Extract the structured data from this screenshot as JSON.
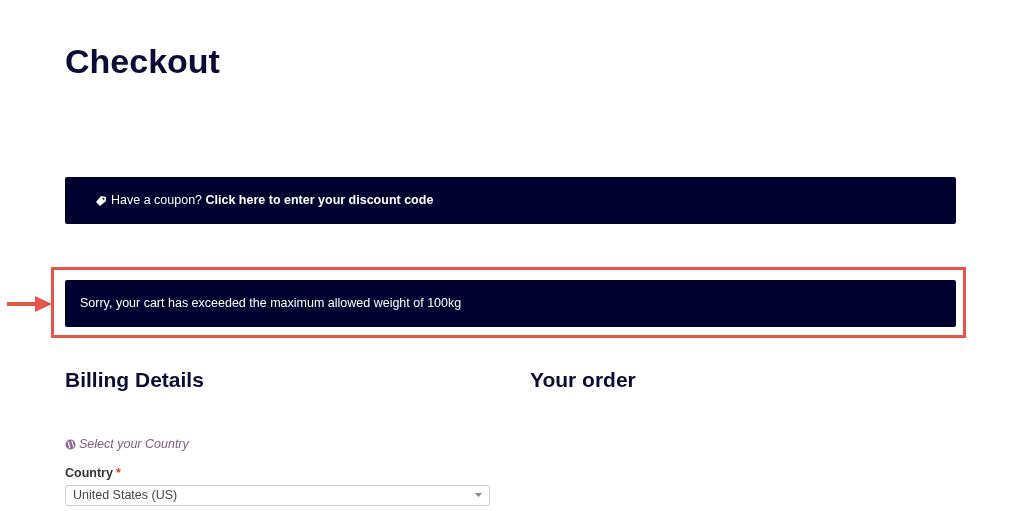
{
  "page_title": "Checkout",
  "coupon_notice": {
    "text": "Have a coupon?",
    "link": "Click here to enter your discount code"
  },
  "error_notice": {
    "text": "Sorry, your cart has exceeded the maximum allowed weight of 100kg",
    "highlighted": true
  },
  "billing": {
    "heading": "Billing Details",
    "country_hint": "Select your Country",
    "country_label": "Country",
    "required_mark": "*",
    "country_value": "United States (US)"
  },
  "order": {
    "heading": "Your order"
  }
}
